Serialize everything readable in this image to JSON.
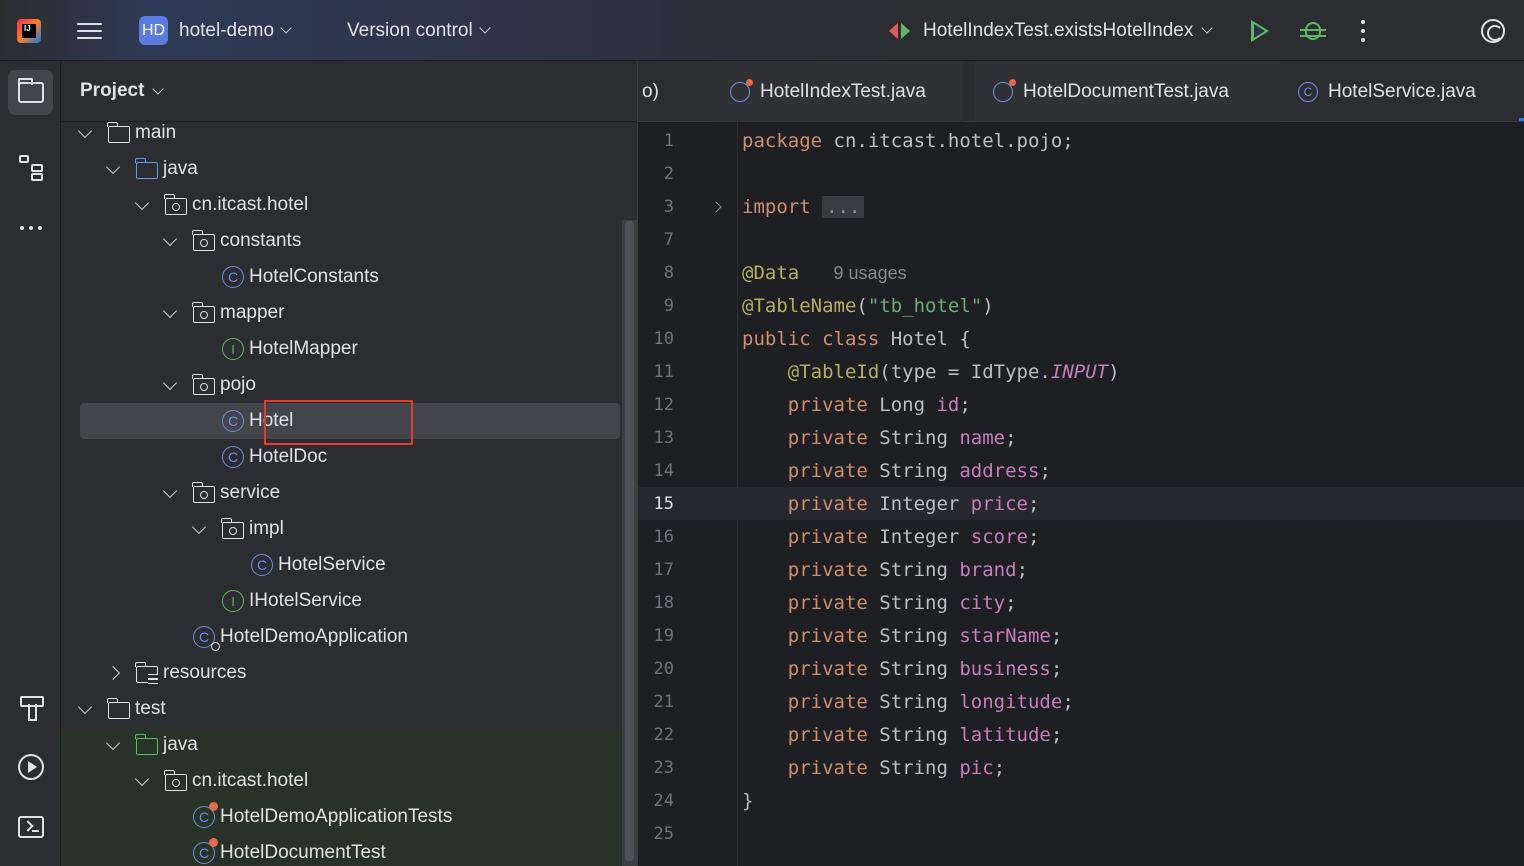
{
  "titlebar": {
    "project_badge": "HD",
    "project_name": "hotel-demo",
    "version_control": "Version control",
    "run_config": "HotelIndexTest.existsHotelIndex"
  },
  "project_panel": {
    "title": "Project",
    "tree": [
      {
        "label": "main",
        "kind": "folder",
        "expanded": true
      },
      {
        "label": "java",
        "kind": "folder-blue",
        "expanded": true
      },
      {
        "label": "cn.itcast.hotel",
        "kind": "package",
        "expanded": true
      },
      {
        "label": "constants",
        "kind": "package",
        "expanded": true
      },
      {
        "label": "HotelConstants",
        "kind": "class"
      },
      {
        "label": "mapper",
        "kind": "package",
        "expanded": true
      },
      {
        "label": "HotelMapper",
        "kind": "interface"
      },
      {
        "label": "pojo",
        "kind": "package",
        "expanded": true
      },
      {
        "label": "Hotel",
        "kind": "class",
        "selected": true
      },
      {
        "label": "HotelDoc",
        "kind": "class"
      },
      {
        "label": "service",
        "kind": "package",
        "expanded": true
      },
      {
        "label": "impl",
        "kind": "package",
        "expanded": true
      },
      {
        "label": "HotelService",
        "kind": "class"
      },
      {
        "label": "IHotelService",
        "kind": "interface"
      },
      {
        "label": "HotelDemoApplication",
        "kind": "class-run"
      },
      {
        "label": "resources",
        "kind": "resources",
        "expanded": false
      },
      {
        "label": "test",
        "kind": "folder",
        "expanded": true
      },
      {
        "label": "java",
        "kind": "folder-green",
        "expanded": true
      },
      {
        "label": "cn.itcast.hotel",
        "kind": "package",
        "expanded": true
      },
      {
        "label": "HotelDemoApplicationTests",
        "kind": "class-test"
      },
      {
        "label": "HotelDocumentTest",
        "kind": "class-test"
      }
    ]
  },
  "editor": {
    "tabs": [
      {
        "label": "o)"
      },
      {
        "label": "HotelIndexTest.java"
      },
      {
        "label": "HotelDocumentTest.java"
      },
      {
        "label": "HotelService.java"
      }
    ],
    "lines": [
      {
        "n": "1",
        "parts": [
          [
            "kw",
            "package"
          ],
          [
            "t",
            " cn.itcast.hotel.pojo;"
          ]
        ]
      },
      {
        "n": "2",
        "parts": []
      },
      {
        "n": "3",
        "parts": [
          [
            "kw",
            "import"
          ],
          [
            "t",
            " "
          ],
          [
            "fold",
            "..."
          ]
        ],
        "foldable": true
      },
      {
        "n": "7",
        "parts": []
      },
      {
        "n": "8",
        "parts": [
          [
            "ann",
            "@Data"
          ],
          [
            "t",
            "   "
          ],
          [
            "hint",
            "9 usages"
          ]
        ]
      },
      {
        "n": "9",
        "parts": [
          [
            "ann",
            "@TableName"
          ],
          [
            "t",
            "("
          ],
          [
            "str",
            "\"tb_hotel\""
          ],
          [
            "t",
            ")"
          ]
        ]
      },
      {
        "n": "10",
        "parts": [
          [
            "kw",
            "public class"
          ],
          [
            "t",
            " Hotel {"
          ]
        ]
      },
      {
        "n": "11",
        "parts": [
          [
            "t",
            "    "
          ],
          [
            "ann",
            "@TableId"
          ],
          [
            "t",
            "(type = IdType."
          ],
          [
            "it",
            "INPUT"
          ],
          [
            "t",
            ")"
          ]
        ]
      },
      {
        "n": "12",
        "parts": [
          [
            "t",
            "    "
          ],
          [
            "kw",
            "private"
          ],
          [
            "t",
            " Long "
          ],
          [
            "fld",
            "id"
          ],
          [
            "t",
            ";"
          ]
        ]
      },
      {
        "n": "13",
        "parts": [
          [
            "t",
            "    "
          ],
          [
            "kw",
            "private"
          ],
          [
            "t",
            " String "
          ],
          [
            "fld",
            "name"
          ],
          [
            "t",
            ";"
          ]
        ]
      },
      {
        "n": "14",
        "parts": [
          [
            "t",
            "    "
          ],
          [
            "kw",
            "private"
          ],
          [
            "t",
            " String "
          ],
          [
            "fld",
            "address"
          ],
          [
            "t",
            ";"
          ]
        ]
      },
      {
        "n": "15",
        "parts": [
          [
            "t",
            "    "
          ],
          [
            "kw",
            "private"
          ],
          [
            "t",
            " Integer "
          ],
          [
            "fld",
            "price"
          ],
          [
            "t",
            ";"
          ]
        ],
        "current": true
      },
      {
        "n": "16",
        "parts": [
          [
            "t",
            "    "
          ],
          [
            "kw",
            "private"
          ],
          [
            "t",
            " Integer "
          ],
          [
            "fld",
            "score"
          ],
          [
            "t",
            ";"
          ]
        ]
      },
      {
        "n": "17",
        "parts": [
          [
            "t",
            "    "
          ],
          [
            "kw",
            "private"
          ],
          [
            "t",
            " String "
          ],
          [
            "fld",
            "brand"
          ],
          [
            "t",
            ";"
          ]
        ]
      },
      {
        "n": "18",
        "parts": [
          [
            "t",
            "    "
          ],
          [
            "kw",
            "private"
          ],
          [
            "t",
            " String "
          ],
          [
            "fld",
            "city"
          ],
          [
            "t",
            ";"
          ]
        ]
      },
      {
        "n": "19",
        "parts": [
          [
            "t",
            "    "
          ],
          [
            "kw",
            "private"
          ],
          [
            "t",
            " String "
          ],
          [
            "fld",
            "starName"
          ],
          [
            "t",
            ";"
          ]
        ]
      },
      {
        "n": "20",
        "parts": [
          [
            "t",
            "    "
          ],
          [
            "kw",
            "private"
          ],
          [
            "t",
            " String "
          ],
          [
            "fld",
            "business"
          ],
          [
            "t",
            ";"
          ]
        ]
      },
      {
        "n": "21",
        "parts": [
          [
            "t",
            "    "
          ],
          [
            "kw",
            "private"
          ],
          [
            "t",
            " String "
          ],
          [
            "fld",
            "longitude"
          ],
          [
            "t",
            ";"
          ]
        ]
      },
      {
        "n": "22",
        "parts": [
          [
            "t",
            "    "
          ],
          [
            "kw",
            "private"
          ],
          [
            "t",
            " String "
          ],
          [
            "fld",
            "latitude"
          ],
          [
            "t",
            ";"
          ]
        ]
      },
      {
        "n": "23",
        "parts": [
          [
            "t",
            "    "
          ],
          [
            "kw",
            "private"
          ],
          [
            "t",
            " String "
          ],
          [
            "fld",
            "pic"
          ],
          [
            "t",
            ";"
          ]
        ]
      },
      {
        "n": "24",
        "parts": [
          [
            "t",
            "}"
          ]
        ]
      },
      {
        "n": "25",
        "parts": []
      }
    ]
  }
}
